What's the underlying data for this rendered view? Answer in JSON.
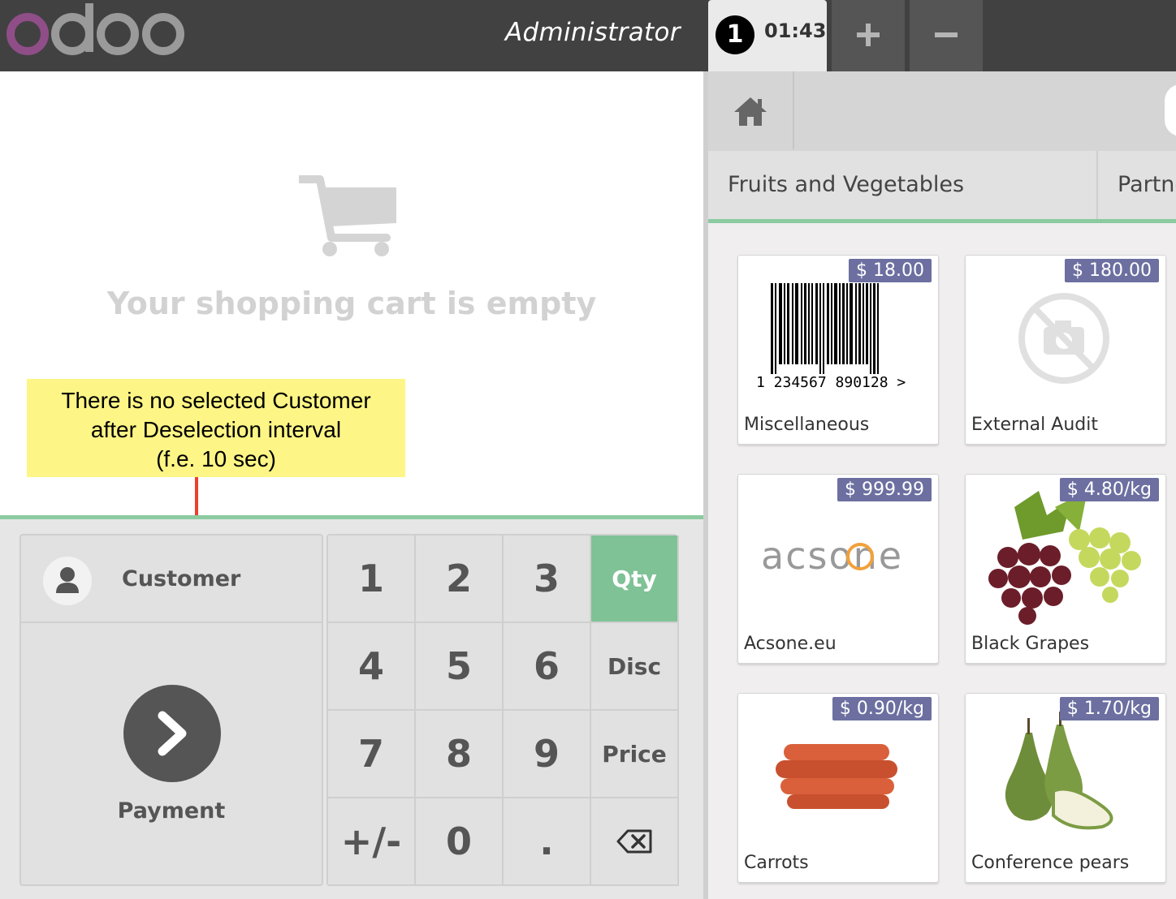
{
  "header": {
    "logo_text": "odoo",
    "user_name": "Administrator",
    "order": {
      "number": "1",
      "time": "01:43"
    },
    "add_order_icon": "plus-icon",
    "remove_order_icon": "minus-icon"
  },
  "cart": {
    "empty_message": "Your shopping cart is empty"
  },
  "annotation": {
    "lines": [
      "There is no selected Customer",
      "after Deselection interval",
      "(f.e. 10 sec)"
    ],
    "color": "#fdf585",
    "arrow_color": "#e8412c"
  },
  "actionpad": {
    "customer_label": "Customer",
    "payment_label": "Payment"
  },
  "numpad": {
    "keys": [
      [
        "1",
        "2",
        "3",
        "Qty"
      ],
      [
        "4",
        "5",
        "6",
        "Disc"
      ],
      [
        "7",
        "8",
        "9",
        "Price"
      ],
      [
        "+/-",
        "0",
        ".",
        "⌫"
      ]
    ],
    "selected_mode": "Qty",
    "accent_color": "#7fc296"
  },
  "products_panel": {
    "home_icon": "home-icon",
    "categories": [
      "Fruits and Vegetables",
      "Partne"
    ],
    "products": [
      {
        "name": "Miscellaneous",
        "price": "$ 18.00",
        "image": "barcode",
        "barcode_text": "1 234567 890128 >"
      },
      {
        "name": "External Audit",
        "price": "$ 180.00",
        "image": "no-image-icon"
      },
      {
        "name": "Acsone.eu",
        "price": "$ 999.99",
        "image": "acsone-logo",
        "logo_text": "acsone"
      },
      {
        "name": "Black Grapes",
        "price": "$ 4.80/kg",
        "image": "grapes"
      },
      {
        "name": "Carrots",
        "price": "$ 0.90/kg",
        "image": "carrots"
      },
      {
        "name": "Conference pears",
        "price": "$ 1.70/kg",
        "image": "pears"
      }
    ]
  }
}
